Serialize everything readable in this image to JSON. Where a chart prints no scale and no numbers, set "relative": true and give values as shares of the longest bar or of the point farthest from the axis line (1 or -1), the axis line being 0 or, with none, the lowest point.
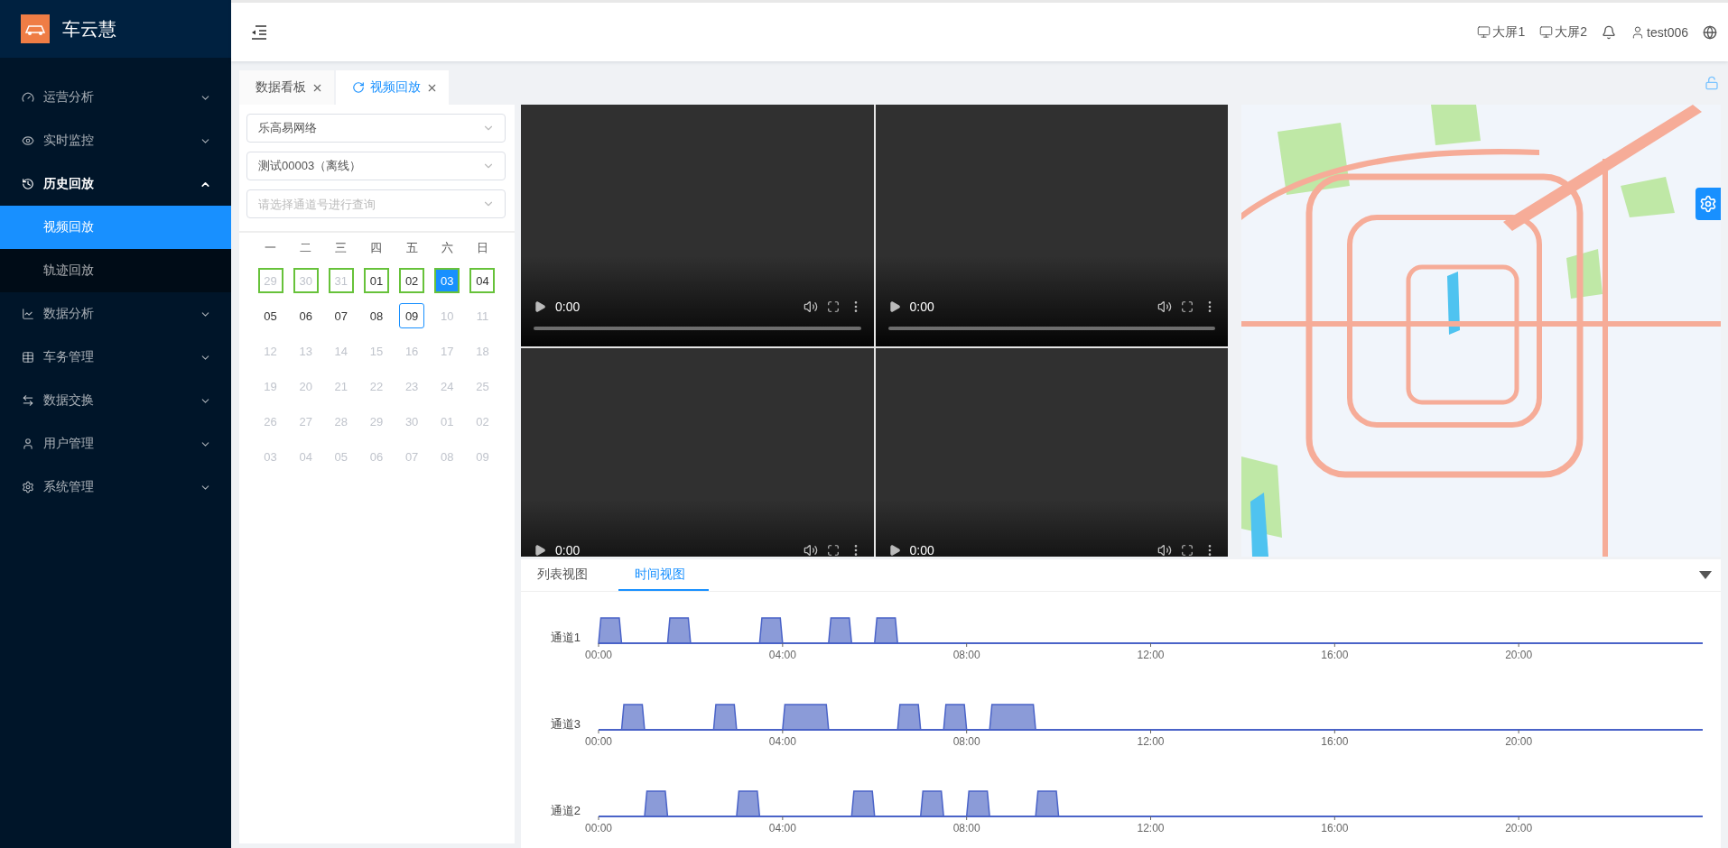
{
  "app": {
    "name": "车云慧"
  },
  "sidebar": {
    "items": [
      {
        "label": "运营分析",
        "expanded": false
      },
      {
        "label": "实时监控",
        "expanded": false
      },
      {
        "label": "历史回放",
        "expanded": true,
        "children": [
          {
            "label": "视频回放",
            "selected": true
          },
          {
            "label": "轨迹回放",
            "selected": false
          }
        ]
      },
      {
        "label": "数据分析",
        "expanded": false
      },
      {
        "label": "车务管理",
        "expanded": false
      },
      {
        "label": "数据交换",
        "expanded": false
      },
      {
        "label": "用户管理",
        "expanded": false
      },
      {
        "label": "系统管理",
        "expanded": false
      }
    ]
  },
  "header": {
    "screens": [
      "大屏1",
      "大屏2"
    ],
    "user": "test006"
  },
  "tabs": [
    {
      "label": "数据看板",
      "selected": false
    },
    {
      "label": "视频回放",
      "selected": true
    }
  ],
  "filters": [
    {
      "value": "乐高易网络"
    },
    {
      "value": "测试00003（离线）"
    },
    {
      "placeholder": "请选择通道号进行查询"
    }
  ],
  "calendar": {
    "weekdays": [
      "一",
      "二",
      "三",
      "四",
      "五",
      "六",
      "日"
    ],
    "weeks": [
      [
        {
          "day": "29",
          "muted": true,
          "has_video": true,
          "selected": false,
          "today": false
        },
        {
          "day": "30",
          "muted": true,
          "has_video": true,
          "selected": false,
          "today": false
        },
        {
          "day": "31",
          "muted": true,
          "has_video": true,
          "selected": false,
          "today": false
        },
        {
          "day": "01",
          "muted": false,
          "has_video": true,
          "selected": false,
          "today": false
        },
        {
          "day": "02",
          "muted": false,
          "has_video": true,
          "selected": false,
          "today": false
        },
        {
          "day": "03",
          "muted": false,
          "has_video": true,
          "selected": true,
          "today": false
        },
        {
          "day": "04",
          "muted": false,
          "has_video": true,
          "selected": false,
          "today": false
        }
      ],
      [
        {
          "day": "05",
          "muted": false,
          "has_video": false,
          "selected": false,
          "today": false
        },
        {
          "day": "06",
          "muted": false,
          "has_video": false,
          "selected": false,
          "today": false
        },
        {
          "day": "07",
          "muted": false,
          "has_video": false,
          "selected": false,
          "today": false
        },
        {
          "day": "08",
          "muted": false,
          "has_video": false,
          "selected": false,
          "today": false
        },
        {
          "day": "09",
          "muted": false,
          "has_video": false,
          "selected": false,
          "today": true
        },
        {
          "day": "10",
          "muted": true,
          "has_video": false,
          "selected": false,
          "today": false
        },
        {
          "day": "11",
          "muted": true,
          "has_video": false,
          "selected": false,
          "today": false
        }
      ],
      [
        {
          "day": "12",
          "muted": true,
          "has_video": false,
          "selected": false,
          "today": false
        },
        {
          "day": "13",
          "muted": true,
          "has_video": false,
          "selected": false,
          "today": false
        },
        {
          "day": "14",
          "muted": true,
          "has_video": false,
          "selected": false,
          "today": false
        },
        {
          "day": "15",
          "muted": true,
          "has_video": false,
          "selected": false,
          "today": false
        },
        {
          "day": "16",
          "muted": true,
          "has_video": false,
          "selected": false,
          "today": false
        },
        {
          "day": "17",
          "muted": true,
          "has_video": false,
          "selected": false,
          "today": false
        },
        {
          "day": "18",
          "muted": true,
          "has_video": false,
          "selected": false,
          "today": false
        }
      ],
      [
        {
          "day": "19",
          "muted": true,
          "has_video": false,
          "selected": false,
          "today": false
        },
        {
          "day": "20",
          "muted": true,
          "has_video": false,
          "selected": false,
          "today": false
        },
        {
          "day": "21",
          "muted": true,
          "has_video": false,
          "selected": false,
          "today": false
        },
        {
          "day": "22",
          "muted": true,
          "has_video": false,
          "selected": false,
          "today": false
        },
        {
          "day": "23",
          "muted": true,
          "has_video": false,
          "selected": false,
          "today": false
        },
        {
          "day": "24",
          "muted": true,
          "has_video": false,
          "selected": false,
          "today": false
        },
        {
          "day": "25",
          "muted": true,
          "has_video": false,
          "selected": false,
          "today": false
        }
      ],
      [
        {
          "day": "26",
          "muted": true,
          "has_video": false,
          "selected": false,
          "today": false
        },
        {
          "day": "27",
          "muted": true,
          "has_video": false,
          "selected": false,
          "today": false
        },
        {
          "day": "28",
          "muted": true,
          "has_video": false,
          "selected": false,
          "today": false
        },
        {
          "day": "29",
          "muted": true,
          "has_video": false,
          "selected": false,
          "today": false
        },
        {
          "day": "30",
          "muted": true,
          "has_video": false,
          "selected": false,
          "today": false
        },
        {
          "day": "01",
          "muted": true,
          "has_video": false,
          "selected": false,
          "today": false
        },
        {
          "day": "02",
          "muted": true,
          "has_video": false,
          "selected": false,
          "today": false
        }
      ],
      [
        {
          "day": "03",
          "muted": true,
          "has_video": false,
          "selected": false,
          "today": false
        },
        {
          "day": "04",
          "muted": true,
          "has_video": false,
          "selected": false,
          "today": false
        },
        {
          "day": "05",
          "muted": true,
          "has_video": false,
          "selected": false,
          "today": false
        },
        {
          "day": "06",
          "muted": true,
          "has_video": false,
          "selected": false,
          "today": false
        },
        {
          "day": "07",
          "muted": true,
          "has_video": false,
          "selected": false,
          "today": false
        },
        {
          "day": "08",
          "muted": true,
          "has_video": false,
          "selected": false,
          "today": false
        },
        {
          "day": "09",
          "muted": true,
          "has_video": false,
          "selected": false,
          "today": false
        }
      ]
    ]
  },
  "videos": [
    {
      "time": "0:00"
    },
    {
      "time": "0:00"
    },
    {
      "time": "0:00"
    },
    {
      "time": "0:00"
    }
  ],
  "timeline": {
    "tabs": [
      {
        "label": "列表视图",
        "selected": false
      },
      {
        "label": "时间视图",
        "selected": true
      }
    ],
    "channels": [
      {
        "chart_data": {
          "type": "area",
          "ylabel": "通道1",
          "relative": true,
          "xlim": [
            0,
            24
          ],
          "xticks": [
            {
              "value": 0,
              "label": "00:00"
            },
            {
              "value": 4,
              "label": "04:00"
            },
            {
              "value": 8,
              "label": "08:00"
            },
            {
              "value": 12,
              "label": "12:00"
            },
            {
              "value": 16,
              "label": "16:00"
            },
            {
              "value": 20,
              "label": "20:00"
            }
          ],
          "x": [
            0,
            0.05,
            0.45,
            0.5,
            1.5,
            1.55,
            1.95,
            2,
            3.5,
            3.55,
            3.95,
            4,
            5,
            5.05,
            5.45,
            5.5,
            6,
            6.05,
            6.45,
            6.5,
            24
          ],
          "series": [
            {
              "color": "#8b9bd8",
              "values": [
                0,
                1,
                1,
                0,
                0,
                1,
                1,
                0,
                0,
                1,
                1,
                0,
                0,
                1,
                1,
                0,
                0,
                1,
                1,
                0,
                0
              ]
            }
          ]
        }
      },
      {
        "chart_data": {
          "type": "area",
          "ylabel": "通道3",
          "relative": true,
          "xlim": [
            0,
            24
          ],
          "xticks": [
            {
              "value": 0,
              "label": "00:00"
            },
            {
              "value": 4,
              "label": "04:00"
            },
            {
              "value": 8,
              "label": "08:00"
            },
            {
              "value": 12,
              "label": "12:00"
            },
            {
              "value": 16,
              "label": "16:00"
            },
            {
              "value": 20,
              "label": "20:00"
            }
          ],
          "x": [
            0,
            0.5,
            0.55,
            0.95,
            1,
            2.5,
            2.55,
            2.95,
            3,
            4,
            4.05,
            4.95,
            5,
            6.5,
            6.55,
            6.95,
            7,
            7.5,
            7.55,
            7.95,
            8,
            8.5,
            8.55,
            9.45,
            9.5,
            24
          ],
          "series": [
            {
              "color": "#8b9bd8",
              "values": [
                0,
                0,
                1,
                1,
                0,
                0,
                1,
                1,
                0,
                0,
                1,
                1,
                0,
                0,
                1,
                1,
                0,
                0,
                1,
                1,
                0,
                0,
                1,
                1,
                0,
                0
              ]
            }
          ]
        }
      },
      {
        "chart_data": {
          "type": "area",
          "ylabel": "通道2",
          "relative": true,
          "xlim": [
            0,
            24
          ],
          "xticks": [
            {
              "value": 0,
              "label": "00:00"
            },
            {
              "value": 4,
              "label": "04:00"
            },
            {
              "value": 8,
              "label": "08:00"
            },
            {
              "value": 12,
              "label": "12:00"
            },
            {
              "value": 16,
              "label": "16:00"
            },
            {
              "value": 20,
              "label": "20:00"
            }
          ],
          "x": [
            0,
            1,
            1.05,
            1.45,
            1.5,
            3,
            3.05,
            3.45,
            3.5,
            5.5,
            5.55,
            5.95,
            6,
            7,
            7.05,
            7.45,
            7.5,
            8,
            8.05,
            8.45,
            8.5,
            9.5,
            9.55,
            9.95,
            10,
            24
          ],
          "series": [
            {
              "color": "#8b9bd8",
              "values": [
                0,
                0,
                1,
                1,
                0,
                0,
                1,
                1,
                0,
                0,
                1,
                1,
                0,
                0,
                1,
                1,
                0,
                0,
                1,
                1,
                0,
                0,
                1,
                1,
                0,
                0
              ]
            }
          ]
        }
      }
    ]
  }
}
